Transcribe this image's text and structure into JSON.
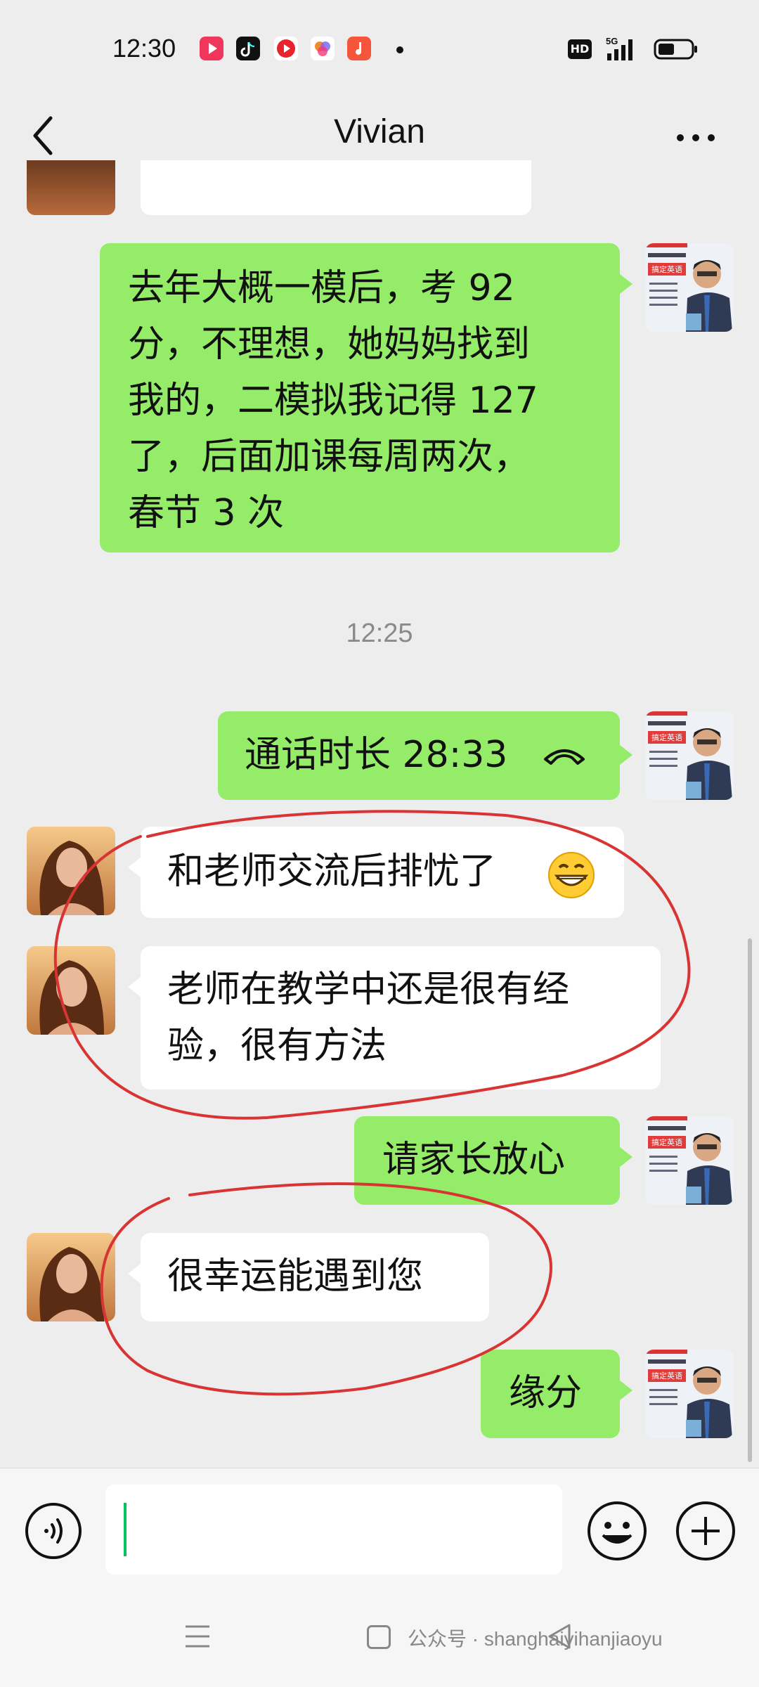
{
  "status_bar": {
    "time": "12:30",
    "network": "5G",
    "hd_label": "HD",
    "icons": [
      "red-app-icon",
      "tiktok-icon",
      "red-video-icon",
      "photo-app-icon",
      "orange-music-icon",
      "notification-dot"
    ]
  },
  "header": {
    "title": "Vivian",
    "back_icon": "chevron-left-icon",
    "more_icon": "more-icon"
  },
  "messages": [
    {
      "side": "right",
      "text_lines": [
        "去年大概一模后，考 92",
        "分，不理想，她妈妈找到",
        "我的，二模拟我记得 127",
        "了，后面加课每周两次，",
        "春节 3 次"
      ]
    },
    {
      "side": "right",
      "text_lines": [
        "通话时长 28:33"
      ],
      "icon": "phone-hangup-icon"
    },
    {
      "side": "left",
      "text_lines": [
        "和老师交流后排忧了"
      ],
      "emoji": "grinning-face-icon"
    },
    {
      "side": "left",
      "text_lines": [
        "老师在教学中还是很有经",
        "验，很有方法"
      ]
    },
    {
      "side": "right",
      "text_lines": [
        "请家长放心"
      ]
    },
    {
      "side": "left",
      "text_lines": [
        "很幸运能遇到您"
      ]
    },
    {
      "side": "right",
      "text_lines": [
        "缘分"
      ]
    }
  ],
  "time_divider": "12:25",
  "teacher_avatar": {
    "line1": "搞定英语"
  },
  "input": {
    "value": ""
  },
  "watermark": "公众号 · shanghaiyihanjiaoyu",
  "colors": {
    "my_bubble": "#95ec69",
    "their_bubble": "#ffffff",
    "background": "#ededed",
    "annotation": "#d93434"
  }
}
